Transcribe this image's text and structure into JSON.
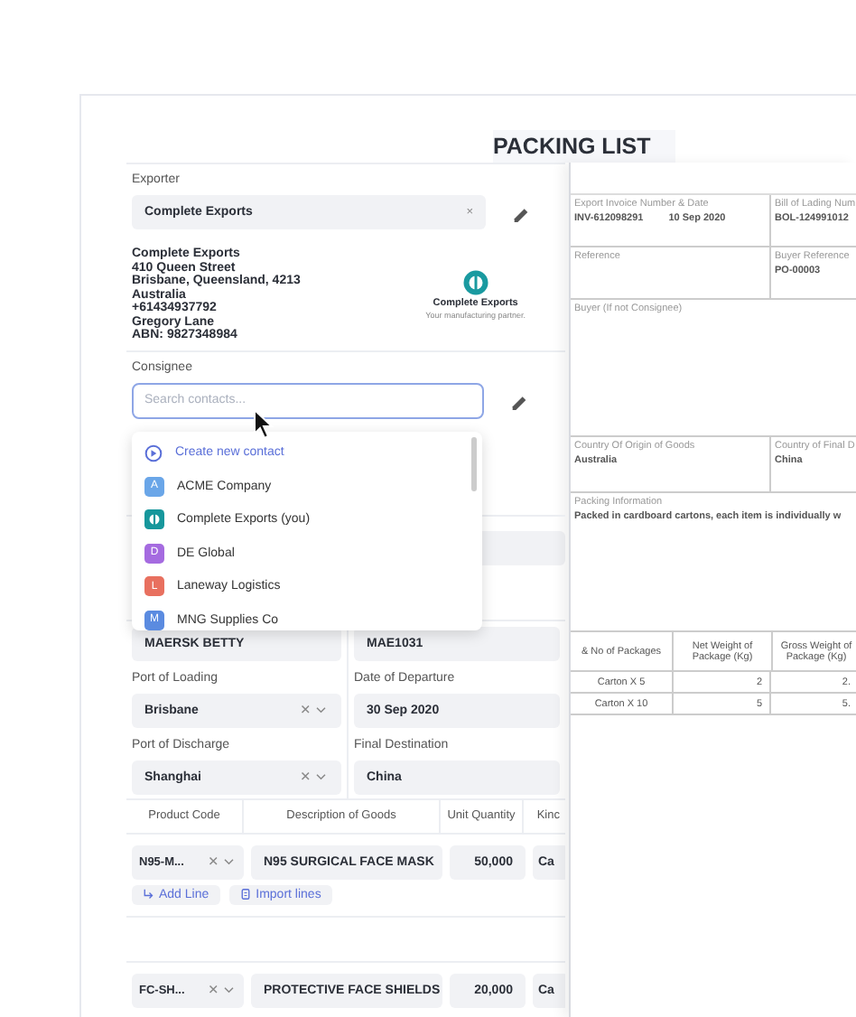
{
  "title": "PACKING LIST",
  "exporter": {
    "label": "Exporter",
    "value": "Complete Exports",
    "clear": "×",
    "address": [
      "Complete Exports",
      "410 Queen Street",
      "Brisbane, Queensland, 4213",
      "Australia",
      "+61434937792",
      "Gregory Lane",
      "ABN: 9827348984"
    ],
    "logo": {
      "name": "Complete Exports",
      "tagline": "Your manufacturing partner."
    }
  },
  "consignee": {
    "label": "Consignee",
    "placeholder": "Search contacts...",
    "options": [
      {
        "label": "Create new contact",
        "kind": "action"
      },
      {
        "label": "ACME Company",
        "kind": "initial",
        "initial": "A",
        "color": "#6aa6e8"
      },
      {
        "label": "Complete Exports (you)",
        "kind": "logo",
        "color": "#17979c"
      },
      {
        "label": "DE Global",
        "kind": "initial",
        "initial": "D",
        "color": "#a56be0"
      },
      {
        "label": "Laneway Logistics",
        "kind": "initial",
        "initial": "L",
        "color": "#e8705f"
      },
      {
        "label": "MNG Supplies Co",
        "kind": "initial",
        "initial": "M",
        "color": "#5b8be0"
      }
    ]
  },
  "vessel": {
    "value": "MAERSK BETTY"
  },
  "voyage": {
    "value": "MAE1031"
  },
  "fields": [
    {
      "label": "Port of Loading",
      "value": "Brisbane",
      "kind": "select"
    },
    {
      "label": "Date of Departure",
      "value": "30 Sep 2020",
      "kind": "text"
    },
    {
      "label": "Port of Discharge",
      "value": "Shanghai",
      "kind": "select"
    },
    {
      "label": "Final Destination",
      "value": "China",
      "kind": "text"
    }
  ],
  "lines": {
    "columns": [
      "Product Code",
      "Description of Goods",
      "Unit Quantity",
      "Kinc"
    ],
    "rows": [
      {
        "code": "N95-M...",
        "description": "N95 SURGICAL FACE MASK",
        "quantity": "50,000",
        "kind": "Ca",
        "buttons": true
      },
      {
        "code": "FC-SH...",
        "description": "PROTECTIVE FACE SHIELDS",
        "quantity": "20,000",
        "kind": "Ca",
        "buttons": false
      }
    ],
    "add_line": "Add Line",
    "import_lines": "Import lines"
  },
  "document": {
    "invoice": {
      "label": "Export Invoice Number & Date",
      "value": "INV-612098291",
      "date": "10 Sep 2020"
    },
    "bill": {
      "label": "Bill of Lading Num",
      "value": "BOL-124991012"
    },
    "reference": {
      "label": "Reference"
    },
    "buyer_reference": {
      "label": "Buyer Reference",
      "value": "PO-00003"
    },
    "buyer": {
      "label": "Buyer (If not Consignee)"
    },
    "origin": {
      "label": "Country Of Origin of Goods",
      "value": "Australia"
    },
    "destination": {
      "label": "Country of Final D",
      "value": "China"
    },
    "packing": {
      "label": "Packing Information",
      "value": "Packed in cardboard cartons, each item is individually w"
    },
    "packages": {
      "columns": [
        "& No of Packages",
        "Net Weight of Package (Kg)",
        "Gross Weight of Package (Kg)"
      ],
      "rows": [
        [
          "Carton X 5",
          "2",
          "2."
        ],
        [
          "Carton X 10",
          "5",
          "5."
        ]
      ]
    }
  }
}
